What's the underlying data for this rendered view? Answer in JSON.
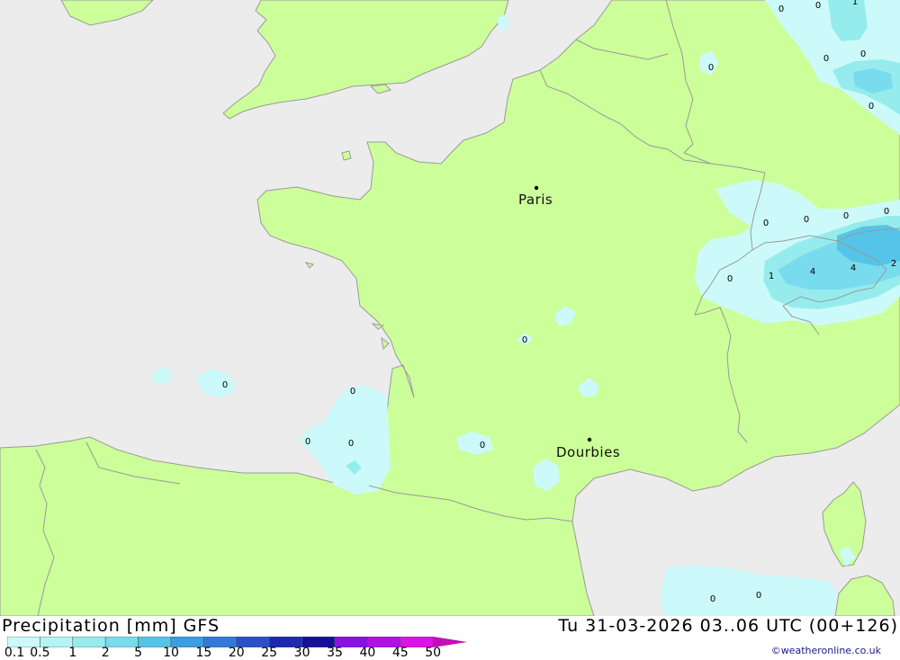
{
  "title_left": "Precipitation [mm] GFS",
  "title_right": "Tu 31-03-2026 03..06 UTC (00+126)",
  "credit": "©weatheronline.co.uk",
  "colors": {
    "sea": "#ececec",
    "land": "#ccff99",
    "border": "#999999",
    "coast": "#9a9a9a"
  },
  "legend": {
    "ticks": [
      "0.1",
      "0.5",
      "1",
      "2",
      "5",
      "10",
      "15",
      "20",
      "25",
      "30",
      "35",
      "40",
      "45",
      "50"
    ],
    "colors": [
      "#ccfafa",
      "#b4f4f4",
      "#96ecec",
      "#78dcee",
      "#56c4e8",
      "#3a9ee0",
      "#3478d8",
      "#2a50c8",
      "#1c2ab0",
      "#14109a",
      "#8a10e8",
      "#b010e8",
      "#e010e8",
      "#c010b4"
    ]
  },
  "cities": [
    {
      "name": "Paris"
    },
    {
      "name": "Dourbies"
    }
  ],
  "value_labels": [
    "0",
    "0",
    "1",
    "0",
    "0",
    "0",
    "0",
    "0",
    "0",
    "0",
    "1",
    "4",
    "4",
    "2",
    "0",
    "0",
    "0",
    "0",
    "0",
    "0",
    "0",
    "0",
    "0",
    "0"
  ]
}
